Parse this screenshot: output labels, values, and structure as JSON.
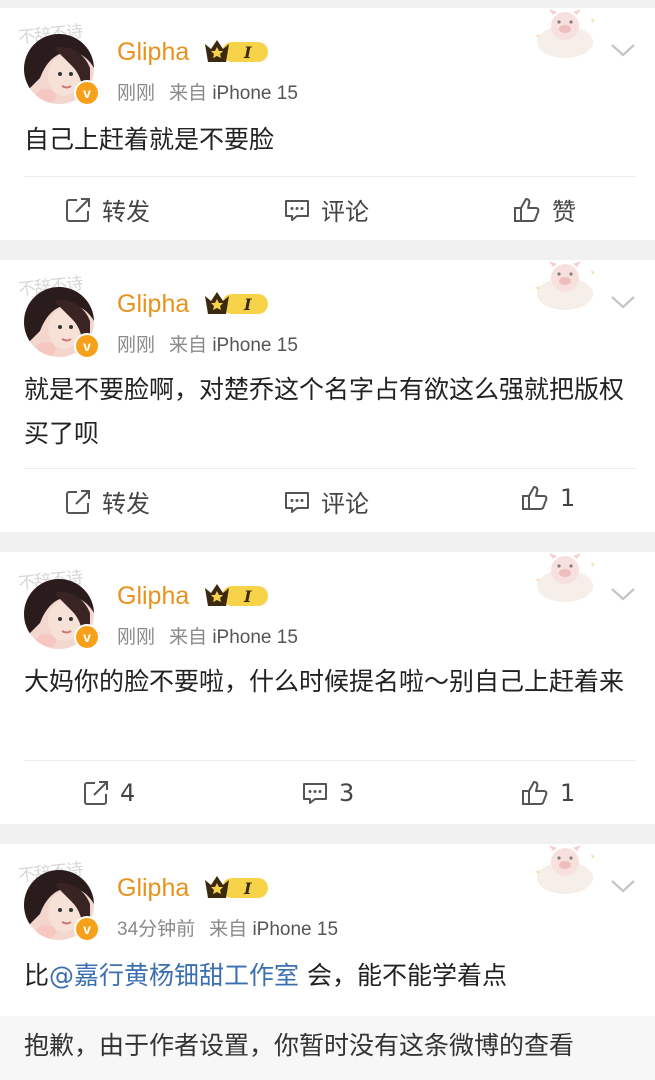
{
  "posts": [
    {
      "watermark": "不辞不诗",
      "user": {
        "name": "Glipha",
        "level_badge": "I",
        "verified": "v"
      },
      "time": "刚刚",
      "source_prefix": "来自",
      "device": "iPhone 15",
      "content": "自己上赶着就是不要脸",
      "actions": {
        "repost": "转发",
        "comment": "评论",
        "like": "赞"
      }
    },
    {
      "watermark": "不辞不诗",
      "user": {
        "name": "Glipha",
        "level_badge": "I",
        "verified": "v"
      },
      "time": "刚刚",
      "source_prefix": "来自",
      "device": "iPhone 15",
      "content": "就是不要脸啊，对楚乔这个名字占有欲这么强就把版权买了呗",
      "actions": {
        "repost": "转发",
        "comment": "评论",
        "like": "1"
      }
    },
    {
      "watermark": "不辞不诗",
      "user": {
        "name": "Glipha",
        "level_badge": "I",
        "verified": "v"
      },
      "time": "刚刚",
      "source_prefix": "来自",
      "device": "iPhone 15",
      "content": "大妈你的脸不要啦，什么时候提名啦～别自己上赶着来",
      "actions": {
        "repost": "4",
        "comment": "3",
        "like": "1"
      }
    },
    {
      "watermark": "不辞不诗",
      "user": {
        "name": "Glipha",
        "level_badge": "I",
        "verified": "v"
      },
      "time": "34分钟前",
      "source_prefix": "来自",
      "device": "iPhone 15",
      "content_prefix": "比",
      "mention": "@嘉行黄杨钿甜工作室",
      "content_suffix": " 会，能不能学着点"
    }
  ],
  "notice": "抱歉，由于作者设置，你暂时没有这条微博的查看",
  "colors": {
    "username": "#e8911c",
    "badge": "#f7a11a",
    "mention": "#3a6fb0",
    "meta": "#8a8a8a",
    "background": "#f1f1f1"
  }
}
